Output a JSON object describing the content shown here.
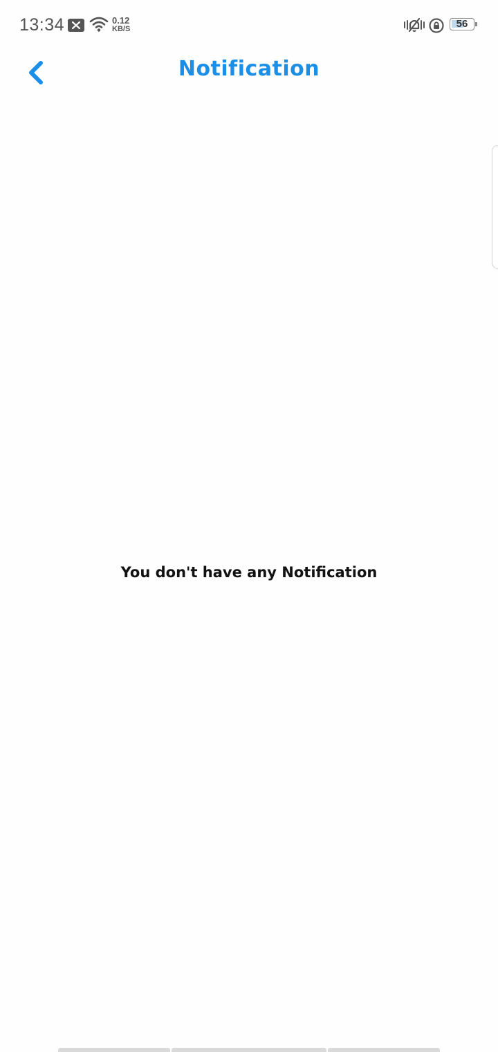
{
  "status_bar": {
    "time": "13:34",
    "speed_value": "0.12",
    "speed_unit": "KB/S",
    "battery": "56",
    "icons": [
      "notification-x-icon",
      "wifi-icon",
      "vibrate-icon",
      "rotation-lock-icon",
      "battery-icon"
    ]
  },
  "header": {
    "back_icon": "chevron-left-icon",
    "title": "Notification"
  },
  "main": {
    "empty_message": "You don't have any Notification"
  },
  "colors": {
    "accent": "#1b8fe8",
    "text": "#111111",
    "status": "#555555",
    "background": "#fefefe"
  }
}
